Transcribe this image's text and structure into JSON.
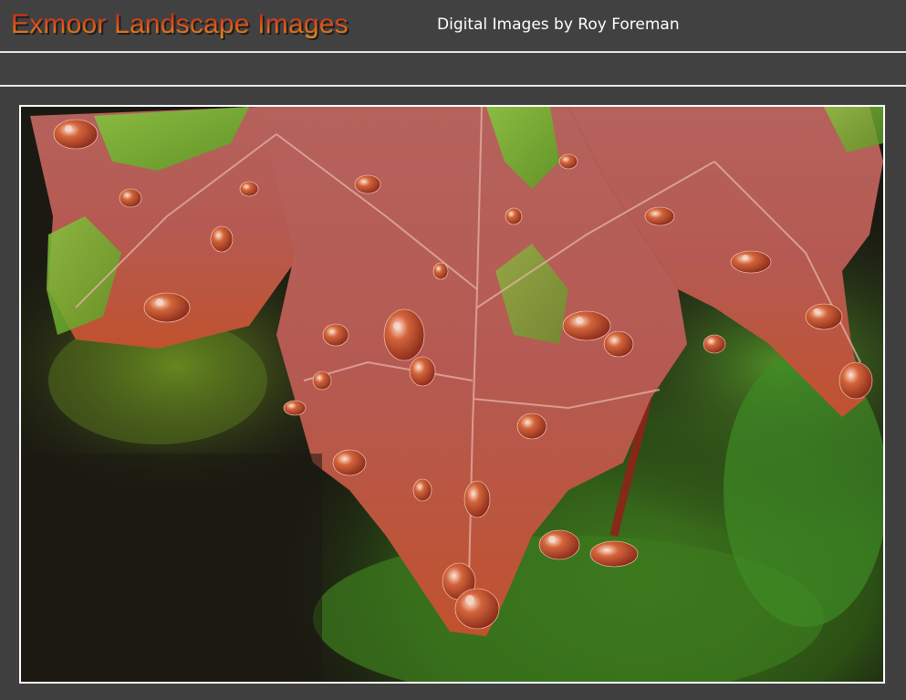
{
  "header": {
    "site_title": "Exmoor Landscape Images",
    "subtitle": "Digital Images by Roy Foreman"
  },
  "photo": {
    "subject": "autumn-leaf-with-raindrops",
    "colors": {
      "leaf_red": "#b85a55",
      "leaf_green": "#7cbf3a",
      "background_dark": "#1b1a12",
      "background_green": "#3f6e1e",
      "frame": "#ffffff",
      "page_background": "#404040"
    }
  }
}
